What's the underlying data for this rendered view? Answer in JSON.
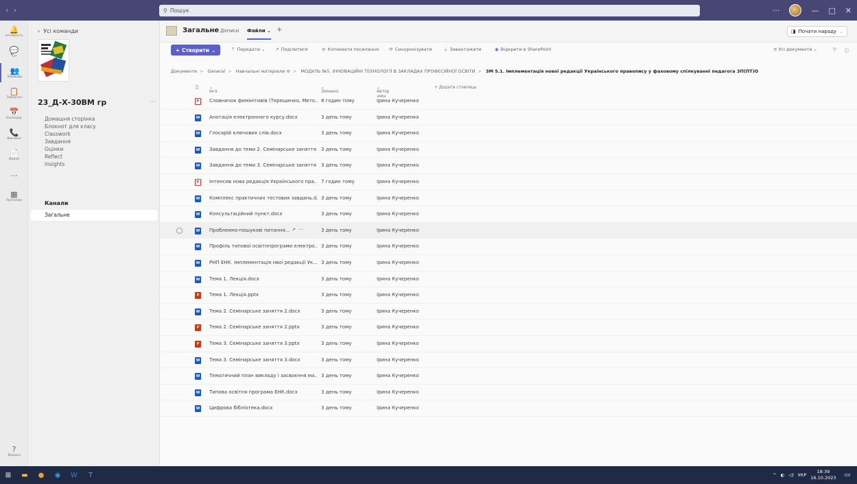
{
  "titlebar": {
    "search_placeholder": "Пошук",
    "more": "···",
    "minimize": "—",
    "maximize": "□",
    "close": "✕"
  },
  "rail": [
    {
      "label": "Активність",
      "icon": "🔔"
    },
    {
      "label": "Чат",
      "icon": "💬"
    },
    {
      "label": "Команди",
      "icon": "👥"
    },
    {
      "label": "Завдання",
      "icon": "📋"
    },
    {
      "label": "Календар",
      "icon": "📅"
    },
    {
      "label": "Виклики",
      "icon": "📞"
    },
    {
      "label": "Файли",
      "icon": "📄"
    }
  ],
  "rail_more": "···",
  "rail_apps": "Програми",
  "rail_help": "Довідка",
  "team": {
    "back": "Усі команди",
    "name": "23_Д-Х-30ВМ гр",
    "more": "···",
    "links": [
      "Домашня сторінка",
      "Блокнот для класу",
      "Classwork",
      "Завдання",
      "Оцінки",
      "Reflect",
      "Insights"
    ],
    "channels_title": "Канали",
    "channel": "Загальне"
  },
  "channel": {
    "title": "Загальне",
    "tabs": [
      "Дописи",
      "Файли",
      "+"
    ],
    "meet": "Почати нараду"
  },
  "toolbar": {
    "create": "Створити",
    "items": [
      "Передати",
      "Поділитися",
      "Копіювати посилання",
      "Синхронізувати",
      "Завантажити",
      "Відкрити в SharePoint"
    ],
    "view": "Усі документи"
  },
  "breadcrumb": {
    "parts": [
      "Документи",
      "General",
      "Навчальні матеріали",
      "МОДУЛЬ №5. ІННОВАЦІЙНІ ТЕХНОЛОГІЇ В ЗАКЛАДАХ ПРОФЕСІЙНОЇ ОСВІТИ"
    ],
    "current": "ЗМ 5.1. Імплементація нової редакції Українського правопису у фаховому спілкуванні педагога ЗП(ПТ)О"
  },
  "columns": {
    "name": "Ім'я",
    "modified": "Змінено",
    "author": "Автор змін",
    "add": "+ Додати стовпець"
  },
  "files": [
    {
      "name": "Словничок фемінітивів (Терещенко, Мето...",
      "type": "pdf",
      "modified": "8 годин тому",
      "author": "Ірина Кучеренко"
    },
    {
      "name": "Анотація електронного курсу.docx",
      "type": "docx",
      "modified": "3 день тому",
      "author": "Ірина Кучеренко"
    },
    {
      "name": "Глосарій ключових слів.docx",
      "type": "docx",
      "modified": "3 день тому",
      "author": "Ірина Кучеренко"
    },
    {
      "name": "Завдання до теми 2. Семінарське заняття ...",
      "type": "docx",
      "modified": "3 день тому",
      "author": "Ірина Кучеренко"
    },
    {
      "name": "Завдання до теми 3. Семінарське заняття ...",
      "type": "docx",
      "modified": "3 день тому",
      "author": "Ірина Кучеренко"
    },
    {
      "name": "Інтенсив нова редакція Українського пра...",
      "type": "pdf",
      "modified": "7 годин тому",
      "author": "Ірина Кучеренко"
    },
    {
      "name": "Комплекс практичних тестових завдань.d...",
      "type": "docx",
      "modified": "3 день тому",
      "author": "Ірина Кучеренко"
    },
    {
      "name": "Консультаційний пункт.docx",
      "type": "docx",
      "modified": "3 день тому",
      "author": "Ірина Кучеренко"
    },
    {
      "name": "Проблемно-пошукові питання...",
      "type": "docx",
      "modified": "3 день тому",
      "author": "Ірина Кучеренко",
      "hover": true
    },
    {
      "name": "Профіль типової освітнпрограми електро...",
      "type": "docx",
      "modified": "3 день тому",
      "author": "Ірина Кучеренко"
    },
    {
      "name": "РНП ЕНК. Імплементація нвоі редакції Ук...",
      "type": "docx",
      "modified": "3 день тому",
      "author": "Ірина Кучеренко"
    },
    {
      "name": "Тема 1. Лекція.docx",
      "type": "docx",
      "modified": "3 день тому",
      "author": "Ірина Кучеренко"
    },
    {
      "name": "Тема 1. Лекція.pptx",
      "type": "pptx",
      "modified": "3 день тому",
      "author": "Ірина Кучеренко"
    },
    {
      "name": "Тема 2. Семінарське заняття 2.docx",
      "type": "docx",
      "modified": "3 день тому",
      "author": "Ірина Кучеренко"
    },
    {
      "name": "Тема 2. Семінарське заняття 2.pptx",
      "type": "pptx",
      "modified": "3 день тому",
      "author": "Ірина Кучеренко"
    },
    {
      "name": "Тема 3. Семінарське заняття 3.pptx",
      "type": "pptx",
      "modified": "3 день тому",
      "author": "Ірина Кучеренко"
    },
    {
      "name": "Тема 3. Семінарське заняття 3.docx",
      "type": "docx",
      "modified": "3 день тому",
      "author": "Ірина Кучеренко"
    },
    {
      "name": "Тематичний план викладу і засвоєння ма...",
      "type": "docx",
      "modified": "3 день тому",
      "author": "Ірина Кучеренко"
    },
    {
      "name": "Типова освітня програма ЕНК.docx",
      "type": "docx",
      "modified": "3 день тому",
      "author": "Ірина Кучеренко"
    },
    {
      "name": "Цифрова бібліотека.docx",
      "type": "docx",
      "modified": "3 день тому",
      "author": "Ірина Кучеренко"
    }
  ],
  "taskbar": {
    "lang": "УКР",
    "time": "18:39",
    "date": "16.10.2023"
  }
}
